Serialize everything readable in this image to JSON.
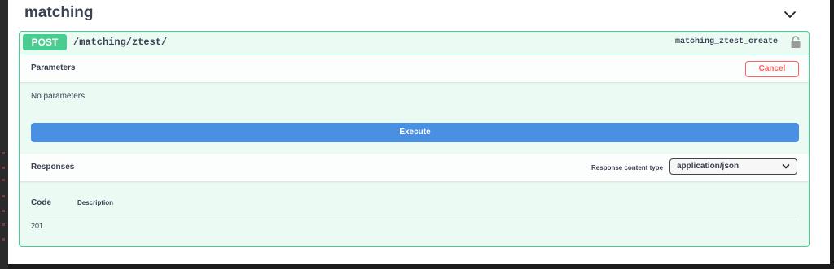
{
  "tag": {
    "title": "matching",
    "chevron_icon": "chevron-down-icon"
  },
  "operation": {
    "method": "POST",
    "path": "/matching/ztest/",
    "operation_id": "matching_ztest_create",
    "lock_icon": "lock-icon",
    "accent_color": "#49cc90"
  },
  "parameters": {
    "title": "Parameters",
    "cancel_label": "Cancel",
    "empty_text": "No parameters"
  },
  "execute": {
    "label": "Execute",
    "color": "#4990e2"
  },
  "responses": {
    "title": "Responses",
    "content_type_label": "Response content type",
    "content_type_value": "application/json",
    "columns": [
      "Code",
      "Description"
    ],
    "rows": [
      {
        "code": "201",
        "description": ""
      }
    ]
  }
}
